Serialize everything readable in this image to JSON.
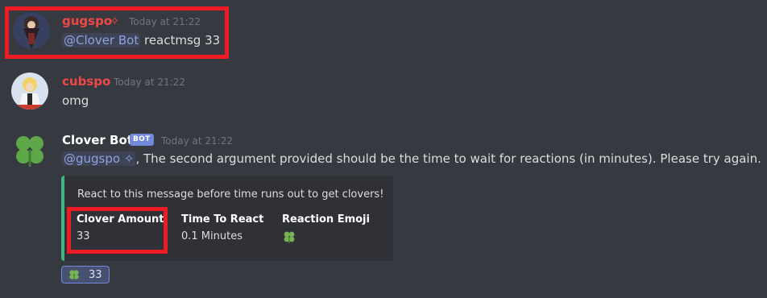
{
  "colors": {
    "background": "#36393f",
    "embed_accent": "#43b581",
    "mention": "#8ea1e1",
    "highlight": "#ed1b24"
  },
  "messages": [
    {
      "author": "gugspo",
      "author_color": "#f04747",
      "author_icon": "sparkle-icon",
      "timestamp": "Today at 21:22",
      "mention": "@Clover Bot",
      "text": " reactmsg 33"
    },
    {
      "author": "cubspo",
      "author_color": "#f04747",
      "timestamp": "Today at 21:22",
      "text": "omg"
    },
    {
      "author": "Clover Bot",
      "author_color": "#ffffff",
      "badge": "BOT",
      "timestamp": "Today at 21:22",
      "mention": "@gugspo",
      "mention_icon": "sparkle-icon",
      "text": ", The second argument provided should be the time to wait for reactions (in minutes). Please try again.",
      "embed": {
        "description": "React to this message before time runs out to get clovers!",
        "fields": [
          {
            "name": "Clover Amount",
            "value": "33"
          },
          {
            "name": "Time To React",
            "value": "0.1 Minutes"
          },
          {
            "name": "Reaction Emoji",
            "value_icon": "four-leaf-clover-icon"
          }
        ]
      },
      "reaction": {
        "emoji": "four-leaf-clover-icon",
        "count": "33"
      }
    }
  ]
}
